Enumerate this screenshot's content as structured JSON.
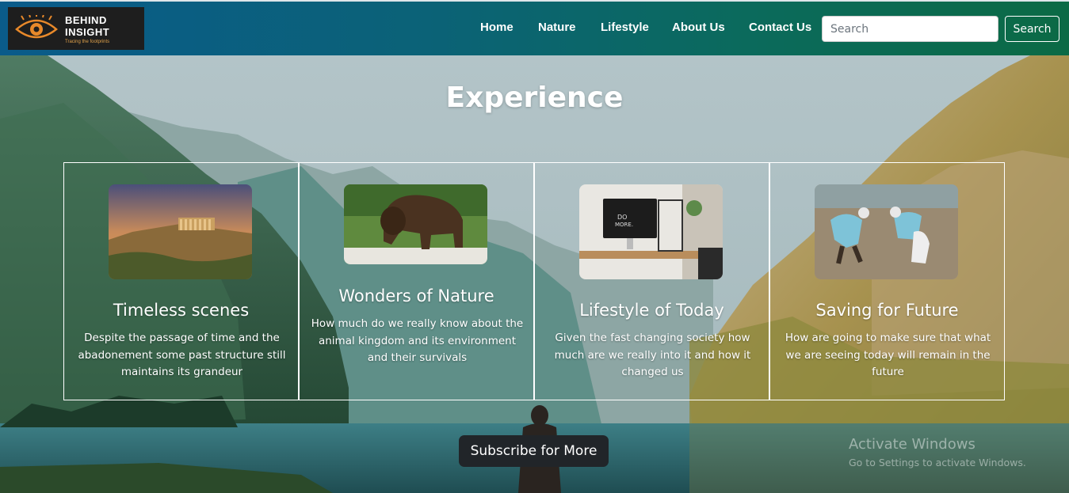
{
  "navbar": {
    "logo": {
      "line1": "BEHIND",
      "line2": "INSIGHT",
      "tagline": "Tracing the footprints"
    },
    "links": [
      {
        "label": "Home"
      },
      {
        "label": "Nature"
      },
      {
        "label": "Lifestyle"
      },
      {
        "label": "About Us"
      },
      {
        "label": "Contact Us"
      }
    ],
    "search": {
      "placeholder": "Search",
      "button_label": "Search"
    }
  },
  "main": {
    "title": "Experience",
    "cards": [
      {
        "title": "Timeless scenes",
        "text": "Despite the passage of time and the abadonement some past structure still maintains its grandeur",
        "image": "ancient-ruins-photo"
      },
      {
        "title": "Wonders of Nature",
        "text": "How much do we really know about the animal kingdom and its environment and their survivals",
        "image": "bison-photo"
      },
      {
        "title": "Lifestyle of Today",
        "text": "Given the fast changing society how much are we really into it and how it changed us",
        "image": "desk-computer-photo"
      },
      {
        "title": "Saving for Future",
        "text": "How are going to make sure that what we are seeing today will remain in the future",
        "image": "beach-cleanup-photo"
      }
    ],
    "subscribe_label": "Subscribe for More"
  },
  "watermark": {
    "title": "Activate Windows",
    "subtitle": "Go to Settings to activate Windows."
  }
}
